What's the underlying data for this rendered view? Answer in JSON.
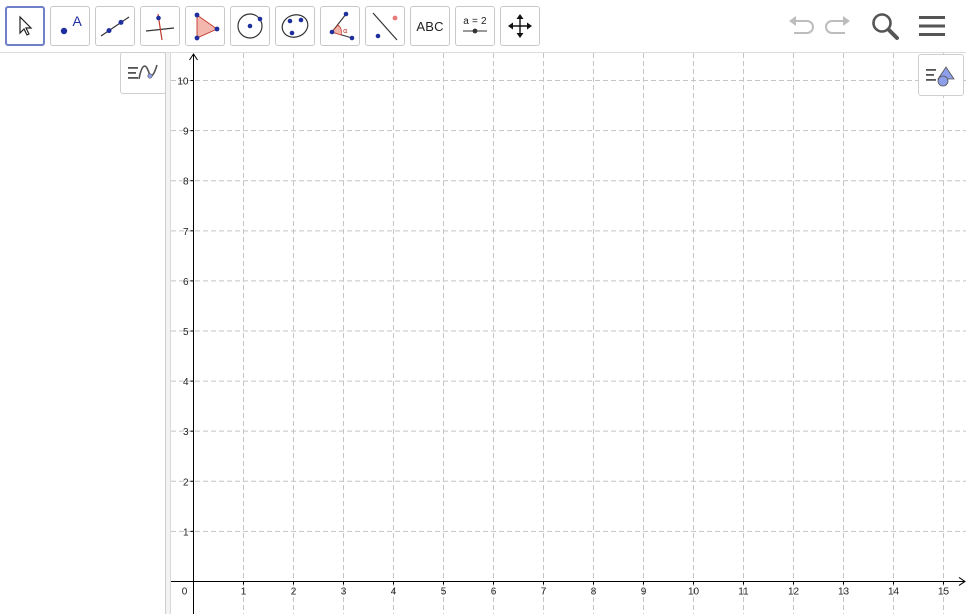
{
  "toolbar": {
    "tools": [
      {
        "name": "move-tool",
        "label": ""
      },
      {
        "name": "point-tool",
        "label": "A"
      },
      {
        "name": "line-tool",
        "label": ""
      },
      {
        "name": "perpendicular-line-tool",
        "label": ""
      },
      {
        "name": "polygon-tool",
        "label": ""
      },
      {
        "name": "circle-tool",
        "label": ""
      },
      {
        "name": "conic-tool",
        "label": ""
      },
      {
        "name": "angle-tool",
        "label": ""
      },
      {
        "name": "reflect-tool",
        "label": ""
      },
      {
        "name": "text-tool",
        "label": "ABC"
      },
      {
        "name": "slider-tool",
        "label": "a = 2"
      },
      {
        "name": "move-graphics-view-tool",
        "label": ""
      }
    ],
    "undo_icon": "undo-icon",
    "redo_icon": "redo-icon",
    "search_icon": "search-icon",
    "menu_icon": "menu-icon"
  },
  "colors": {
    "accent": "#6f7fc8",
    "point_blue": "#1f2f9e",
    "grid": "#c4c4c4",
    "axis": "#000000"
  },
  "graphics": {
    "x_ticks": [
      "0",
      "1",
      "2",
      "3",
      "4",
      "5",
      "6",
      "7",
      "8",
      "9",
      "10",
      "11",
      "12",
      "13",
      "14",
      "15"
    ],
    "y_ticks": [
      "1",
      "2",
      "3",
      "4",
      "5",
      "6",
      "7",
      "8",
      "9",
      "10"
    ],
    "x_range": [
      -0.45,
      15.45
    ],
    "y_range": [
      -0.65,
      10.55
    ],
    "grid": true
  }
}
